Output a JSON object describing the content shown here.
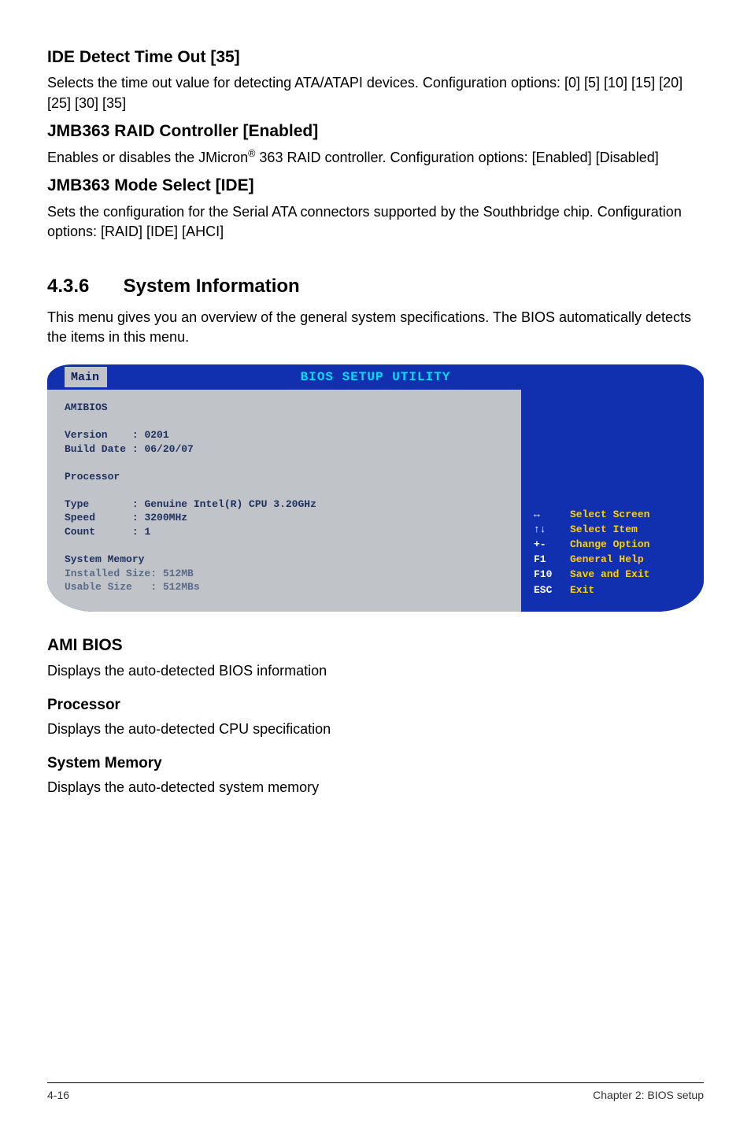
{
  "sections": {
    "ide": {
      "heading": "IDE Detect Time Out [35]",
      "body": "Selects the time out value for detecting ATA/ATAPI devices. Configuration options: [0] [5] [10] [15] [20] [25] [30] [35]"
    },
    "jmb_raid": {
      "heading": "JMB363 RAID Controller [Enabled]",
      "body_pre": "Enables or disables the JMicron",
      "body_post": " 363 RAID controller. Configuration options: [Enabled] [Disabled]"
    },
    "jmb_mode": {
      "heading": "JMB363 Mode Select [IDE]",
      "body": "Sets the configuration for the Serial ATA connectors supported by the Southbridge chip. Configuration options: [RAID] [IDE] [AHCI]"
    },
    "sysinfo": {
      "num": "4.3.6",
      "title": "System Information",
      "body": "This menu gives you an overview of the general system specifications. The BIOS automatically detects the items in this menu."
    },
    "ami": {
      "heading": "AMI BIOS",
      "body": "Displays the auto-detected BIOS information"
    },
    "processor": {
      "heading": "Processor",
      "body": "Displays the auto-detected CPU specification"
    },
    "sysmem": {
      "heading": "System Memory",
      "body": "Displays the auto-detected system memory"
    }
  },
  "bios": {
    "title": "BIOS SETUP UTILITY",
    "tab": "Main",
    "left": {
      "amibios": "AMIBIOS",
      "version_label": "Version    :",
      "version_value": "0201",
      "build_label": "Build Date :",
      "build_value": "06/20/07",
      "proc_label": "Processor",
      "type_label": "Type       :",
      "type_value": "Genuine Intel(R) CPU 3.20GHz",
      "speed_label": "Speed      :",
      "speed_value": "3200MHz",
      "count_label": "Count      :",
      "count_value": "1",
      "sysmem_label": "System Memory",
      "installed_label": "Installed Size:",
      "installed_value": "512MB",
      "usable_label": "Usable Size   :",
      "usable_value": "512MBs"
    },
    "legend": [
      {
        "key": "↔",
        "label": "Select Screen"
      },
      {
        "key": "↑↓",
        "label": "Select Item"
      },
      {
        "key": "+-",
        "label": "Change Option"
      },
      {
        "key": "F1",
        "label": "General Help"
      },
      {
        "key": "F10",
        "label": "Save and Exit"
      },
      {
        "key": "ESC",
        "label": "Exit"
      }
    ]
  },
  "footer": {
    "left": "4-16",
    "right": "Chapter 2: BIOS setup"
  }
}
